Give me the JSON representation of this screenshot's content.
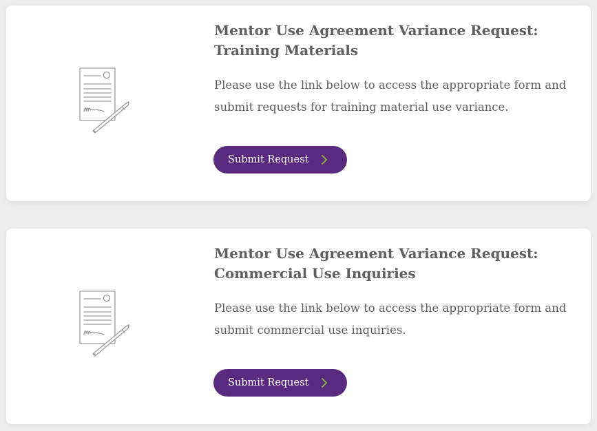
{
  "colors": {
    "background": "#eeeeee",
    "card": "#ffffff",
    "title": "#5f5f5f",
    "text": "#5e5e5e",
    "button": "#5a2a7e",
    "button_text": "#ffffff",
    "chevron": "#8dc63f",
    "icon_stroke": "#9a9a9a"
  },
  "cards": [
    {
      "icon": "signed-document-icon",
      "title_line1": "Mentor Use Agreement Variance Request:",
      "title_line2": "Training Materials",
      "description_line1": "Please use the link below to access the appropriate form and",
      "description_line2": "submit requests for training material use variance.",
      "button_label": "Submit Request",
      "button_icon": "chevron-right-icon"
    },
    {
      "icon": "signed-document-icon",
      "title_line1": "Mentor Use Agreement Variance Request:",
      "title_line2": "Commercial Use Inquiries",
      "description_line1": "Please use the link below to access the appropriate form and",
      "description_line2": "submit commercial use inquiries.",
      "button_label": "Submit Request",
      "button_icon": "chevron-right-icon"
    }
  ]
}
